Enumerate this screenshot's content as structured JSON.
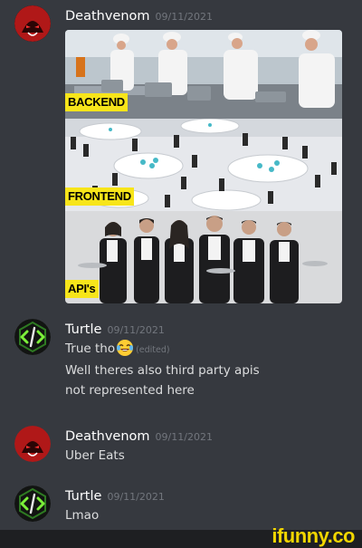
{
  "messages": [
    {
      "username": "Deathvenom",
      "timestamp": "09/11/2021",
      "avatar_icon": "deathvenom-avatar-icon",
      "image": {
        "labels": [
          "BACKEND",
          "FRONTEND",
          "API's"
        ]
      }
    },
    {
      "username": "Turtle",
      "timestamp": "09/11/2021",
      "avatar_icon": "turtle-code-avatar-icon",
      "lines": [
        "True tho",
        "Well theres also third party apis",
        "not represented here"
      ],
      "emoji": "joy-emoji",
      "edited": "(edited)"
    },
    {
      "username": "Deathvenom",
      "timestamp": "09/11/2021",
      "avatar_icon": "deathvenom-avatar-icon",
      "lines": [
        "Uber Eats"
      ]
    },
    {
      "username": "Turtle",
      "timestamp": "09/11/2021",
      "avatar_icon": "turtle-code-avatar-icon",
      "lines": [
        "Lmao"
      ]
    }
  ],
  "watermark": "ifunny.co",
  "colors": {
    "background": "#36393f",
    "username": "#ffffff",
    "timestamp": "#72767d",
    "label_bg": "#f7e51a",
    "watermark": "#f2d600"
  }
}
